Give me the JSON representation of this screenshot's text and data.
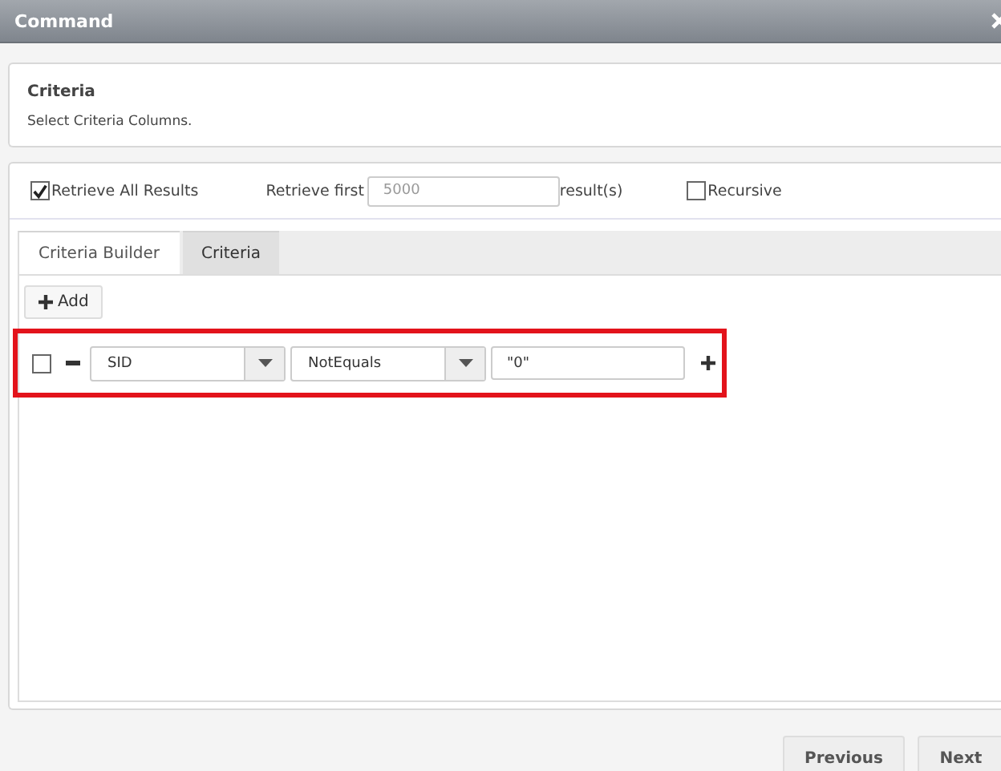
{
  "window": {
    "title": "Command"
  },
  "header": {
    "title": "Criteria",
    "subtitle": "Select Criteria Columns."
  },
  "options": {
    "retrieve_all": {
      "label": "Retrieve All Results",
      "checked": true
    },
    "retrieve_first": {
      "label": "Retrieve first",
      "value": "5000",
      "disabled": true,
      "suffix": "result(s)"
    },
    "recursive": {
      "label": "Recursive",
      "checked": false
    }
  },
  "tabs": [
    {
      "label": "Criteria Builder",
      "selected": true
    },
    {
      "label": "Criteria",
      "selected": false
    }
  ],
  "add_button": "Add",
  "criteria": [
    {
      "checked": false,
      "field": "SID",
      "operator": "NotEquals",
      "value": "\"0\"",
      "highlighted": true
    }
  ],
  "buttons": [
    "Previous",
    "Next"
  ]
}
